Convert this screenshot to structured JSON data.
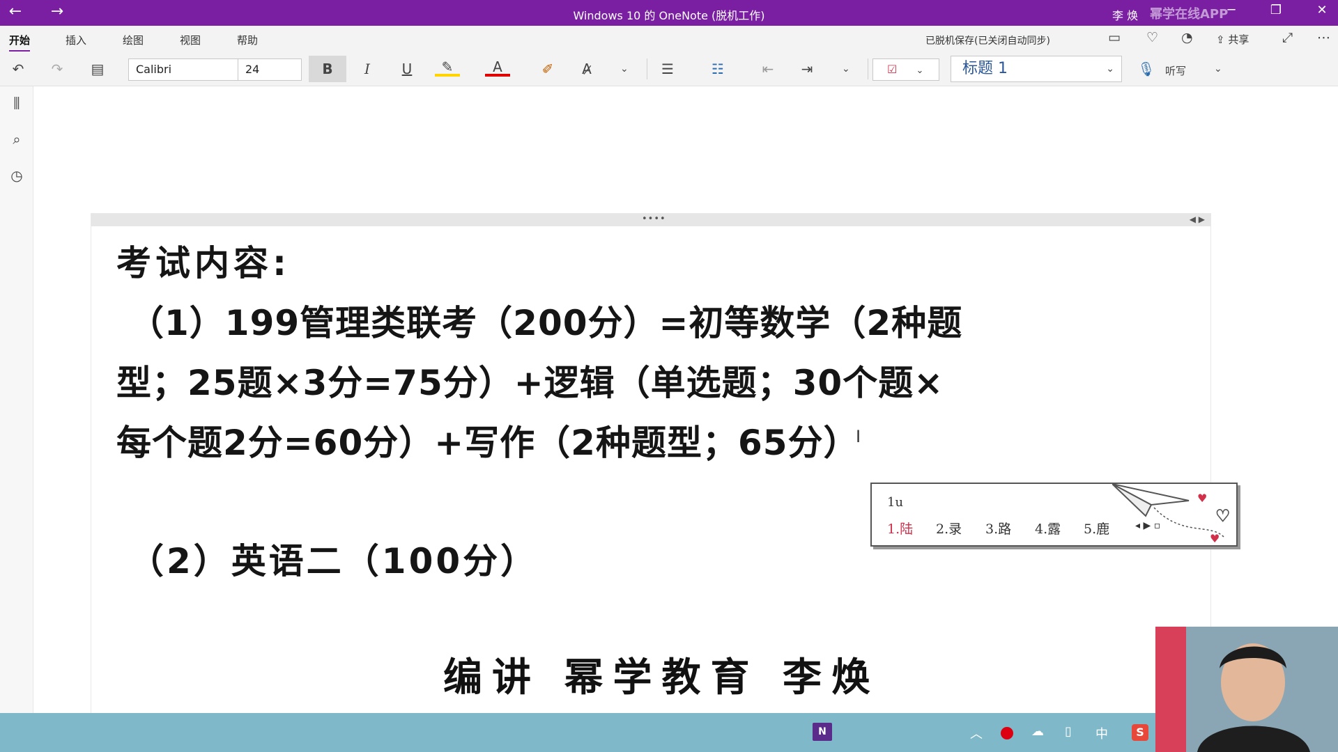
{
  "titlebar": {
    "title": "Windows 10 的 OneNote (脱机工作)",
    "user": "李 焕",
    "watermark": "幂学在线APP",
    "back_icon": "←",
    "forward_icon": "→",
    "minimize_icon": "─",
    "restore_icon": "❐",
    "close_icon": "✕"
  },
  "ribbon": {
    "tabs": [
      "开始",
      "插入",
      "绘图",
      "视图",
      "帮助"
    ],
    "active_tab": "开始",
    "sync_status": "已脱机保存(已关闭自动同步)",
    "share_label": "共享"
  },
  "toolbar": {
    "font_name": "Calibri",
    "font_size": "24",
    "bold": "B",
    "italic": "I",
    "underline": "U",
    "style": "标题 1",
    "dictate_label": "听写"
  },
  "note": {
    "heading": "考试内容:",
    "line1": "（1）199管理类联考（200分）=初等数学（2种题",
    "line2": "型；25题×3分=75分）+逻辑（单选题；30个题×",
    "line3": "每个题2分=60分）+写作（2种题型；65分）",
    "line4": "（2）英语二（100分）"
  },
  "ime": {
    "typed": "1u",
    "candidates": [
      "1.陆",
      "2.录",
      "3.路",
      "4.露",
      "5.鹿"
    ]
  },
  "caption": "编讲 幂学教育 李焕",
  "taskbar": {
    "onenote_label": "N",
    "input_mode": "中",
    "sogou_label": "S"
  },
  "colors": {
    "titlebar": "#7a1fa2",
    "accent": "#7a1fa2",
    "highlight": "#ffd400",
    "font_color": "#e00000",
    "taskbar": "#7fb9c9"
  }
}
